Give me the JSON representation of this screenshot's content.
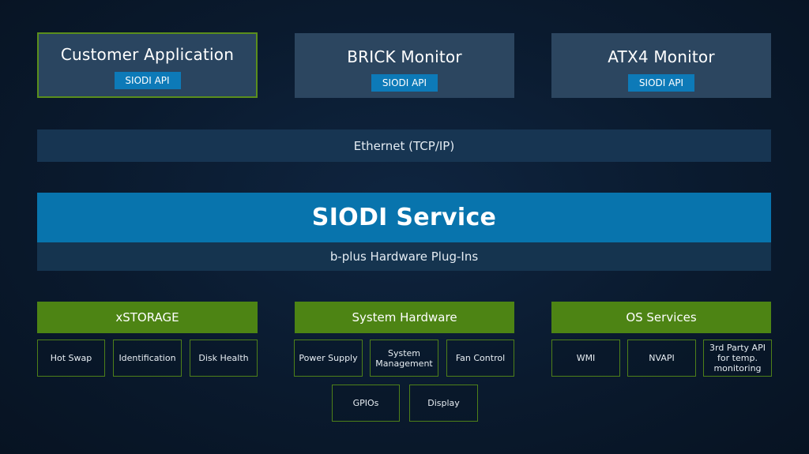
{
  "apps": [
    {
      "title": "Customer Application",
      "api": "SIODI API"
    },
    {
      "title": "BRICK Monitor",
      "api": "SIODI API"
    },
    {
      "title": "ATX4 Monitor",
      "api": "SIODI API"
    }
  ],
  "ethernet": "Ethernet (TCP/IP)",
  "service": "SIODI Service",
  "plugins": "b-plus Hardware Plug-Ins",
  "groups": [
    {
      "title": "xSTORAGE",
      "items": [
        "Hot Swap",
        "Identification",
        "Disk Health"
      ]
    },
    {
      "title": "System Hardware",
      "items": [
        "Power Supply",
        "System Management",
        "Fan Control",
        "GPIOs",
        "Display"
      ]
    },
    {
      "title": "OS Services",
      "items": [
        "WMI",
        "NVAPI",
        "3rd Party API for temp. monitoring"
      ]
    }
  ],
  "colors": {
    "background": "#0a1a2e",
    "app_box": "#2c4660",
    "highlight_border": "#5a8e1c",
    "api_tag": "#0d7ab8",
    "ethernet_bar": "#173552",
    "service_bar": "#0874ad",
    "plugin_bar": "#15344f",
    "group_header": "#4d8414",
    "leaf_border": "#4e8019"
  }
}
